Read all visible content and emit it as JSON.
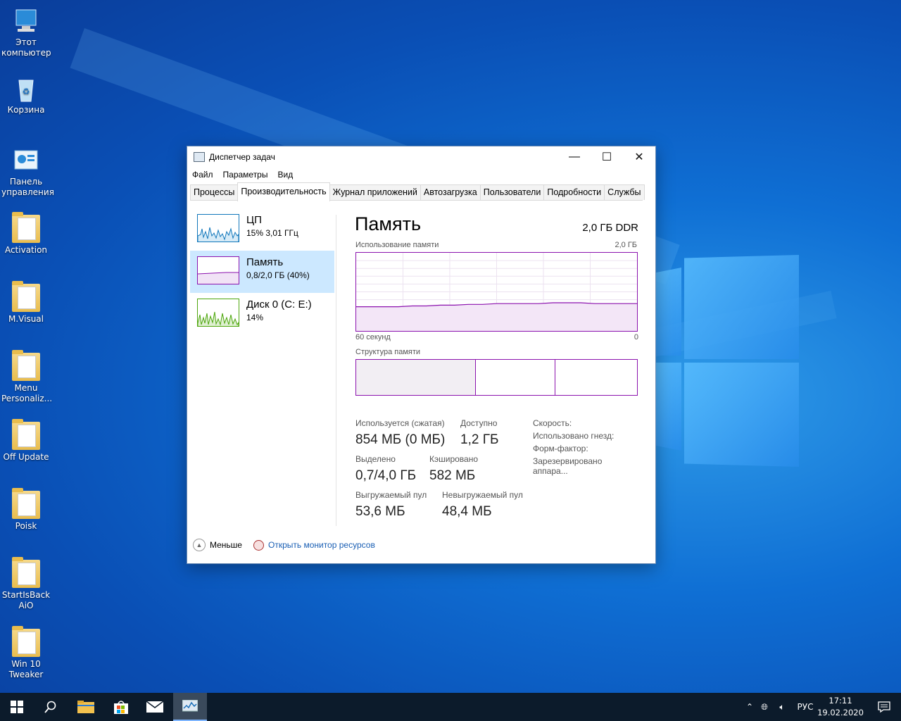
{
  "desktop": {
    "icons": [
      {
        "label": "Этот\nкомпьютер",
        "icon": "computer-icon"
      },
      {
        "label": "Корзина",
        "icon": "recycle-bin-icon"
      },
      {
        "label": "Панель\nуправления",
        "icon": "control-panel-icon"
      },
      {
        "label": "Activation",
        "icon": "folder-icon"
      },
      {
        "label": "M.Visual",
        "icon": "folder-icon"
      },
      {
        "label": "Menu\nPersonaliz...",
        "icon": "folder-icon"
      },
      {
        "label": "Off Update",
        "icon": "folder-icon"
      },
      {
        "label": "Poisk",
        "icon": "folder-icon"
      },
      {
        "label": "StartIsBack\nAiO",
        "icon": "folder-icon"
      },
      {
        "label": "Win 10\nTweaker",
        "icon": "folder-icon"
      }
    ]
  },
  "window": {
    "title": "Диспетчер задач",
    "controls": {
      "minimize": "—",
      "maximize": "☐",
      "close": "✕"
    },
    "menu": [
      "Файл",
      "Параметры",
      "Вид"
    ],
    "tabs": [
      "Процессы",
      "Производительность",
      "Журнал приложений",
      "Автозагрузка",
      "Пользователи",
      "Подробности",
      "Службы"
    ],
    "active_tab": "Производительность",
    "sidebar": [
      {
        "name": "ЦП",
        "value": "15%  3,01 ГГц",
        "color": "#1177bb"
      },
      {
        "name": "Память",
        "value": "0,8/2,0 ГБ (40%)",
        "color": "#8b12ae"
      },
      {
        "name": "Диск 0 (C: E:)",
        "value": "14%",
        "color": "#4da60c"
      }
    ],
    "memory": {
      "title": "Память",
      "type": "2,0 ГБ DDR",
      "usage_label": "Использование памяти",
      "usage_max": "2,0 ГБ",
      "time_left": "60 секунд",
      "time_right": "0",
      "structure_label": "Структура памяти",
      "stats": {
        "in_use_label": "Используется (сжатая)",
        "in_use_value": "854 МБ (0 МБ)",
        "available_label": "Доступно",
        "available_value": "1,2 ГБ",
        "committed_label": "Выделено",
        "committed_value": "0,7/4,0 ГБ",
        "cached_label": "Кэшировано",
        "cached_value": "582 МБ",
        "paged_label": "Выгружаемый пул",
        "paged_value": "53,6 МБ",
        "nonpaged_label": "Невыгружаемый пул",
        "nonpaged_value": "48,4 МБ"
      },
      "details": [
        "Скорость:",
        "Использовано гнезд:",
        "Форм-фактор:",
        "Зарезервировано аппара..."
      ],
      "usage_history_pct": [
        31,
        31,
        31,
        31,
        32,
        32,
        33,
        33,
        34,
        34,
        35,
        35,
        35,
        35,
        36,
        36,
        36,
        35,
        35,
        35,
        35
      ]
    },
    "footer": {
      "less": "Меньше",
      "monitor": "Открыть монитор ресурсов"
    }
  },
  "taskbar": {
    "language": "РУС",
    "time": "17:11",
    "date": "19.02.2020"
  },
  "colors": {
    "accent": "#0a6fd4",
    "memory": "#8b12ae"
  }
}
